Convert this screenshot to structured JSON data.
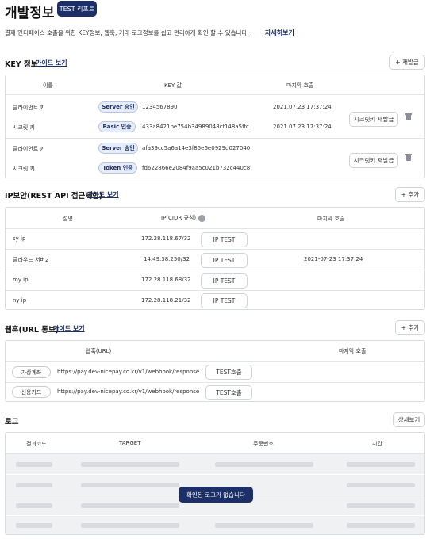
{
  "header": {
    "title": "개발정보",
    "report_button": "TEST 리포트",
    "description": "결제 인터페이스 호출을 위한 KEY정보, 웹훅, 거래 로그정보를 쉽고 편리하게 확인 할 수 있습니다.",
    "more_link": "자세히보기"
  },
  "key_section": {
    "title": "KEY 정보",
    "guide_link": "가이드 보기",
    "reissue_button": "+ 재발급",
    "columns": [
      "이름",
      "KEY 값",
      "마지막 호출"
    ],
    "groups": [
      {
        "rows": [
          {
            "name": "클라이언트 키",
            "tag": "Server 승인",
            "value": "1234567890",
            "last_call": "2021.07.23 17:37:24"
          },
          {
            "name": "시크릿 키",
            "tag": "Basic 인증",
            "value": "433a8421be754b34989048cf148a5ffc",
            "last_call": "2021.07.23 17:37:24"
          }
        ],
        "action": "시크릿키 재발급"
      },
      {
        "rows": [
          {
            "name": "클라이언트 키",
            "tag": "Server 승인",
            "value": "afa39cc5a6a14e3f85e6e0929d027040",
            "last_call": ""
          },
          {
            "name": "시크릿 키",
            "tag": "Token 인증",
            "value": "fd622866e2084f9aa5c021b732c440c8",
            "last_call": ""
          }
        ],
        "action": "시크릿키 재발급"
      }
    ]
  },
  "ip_section": {
    "title": "IP보안(REST API 접근제한)",
    "guide_link": "가이드 보기",
    "add_button": "+ 추가",
    "columns": [
      "설명",
      "IP(CIDR 규칙)",
      "마지막 호출"
    ],
    "info_icon": "i",
    "rows": [
      {
        "desc": "sy ip",
        "ip": "172.28.118.67/32",
        "button": "IP TEST",
        "last_call": ""
      },
      {
        "desc": "클라우드 서버2",
        "ip": "14.49.38.250/32",
        "button": "IP TEST",
        "last_call": "2021-07-23 17:37:24"
      },
      {
        "desc": "my ip",
        "ip": "172.28.118.68/32",
        "button": "IP TEST",
        "last_call": ""
      },
      {
        "desc": "ny ip",
        "ip": "172.28.118.21/32",
        "button": "IP TEST",
        "last_call": ""
      }
    ]
  },
  "webhook_section": {
    "title": "웹훅(URL 통보)",
    "guide_link": "가이드 보기",
    "add_button": "+ 추가",
    "columns": [
      "웹훅(URL)",
      "마지막 호출"
    ],
    "rows": [
      {
        "method": "가상계좌",
        "url": "https://pay.dev-nicepay.co.kr/v1/webhook/response",
        "button": "TEST호출"
      },
      {
        "method": "신용카드",
        "url": "https://pay.dev-nicepay.co.kr/v1/webhook/response",
        "button": "TEST호출"
      }
    ]
  },
  "log_section": {
    "title": "로그",
    "detail_button": "상세보기",
    "columns": [
      "결과코드",
      "TARGET",
      "주문번호",
      "시간"
    ],
    "empty_message": "확인된 로그가 없습니다"
  },
  "colors": {
    "navy": "#1c2f66",
    "tag_bg": "#e6edf8",
    "placeholder_bar": "#d9dbdf",
    "log_body": "#f0f1f3"
  }
}
